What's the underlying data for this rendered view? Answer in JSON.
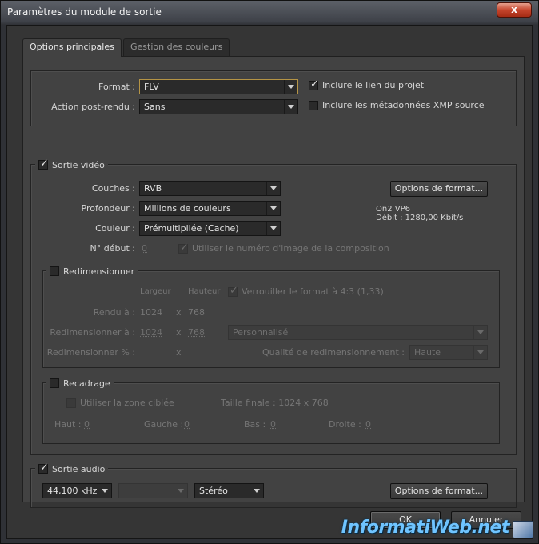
{
  "window": {
    "title": "Paramètres du module de sortie",
    "close_glyph": "x"
  },
  "tabs": [
    {
      "label": "Options principales",
      "active": true
    },
    {
      "label": "Gestion des couleurs",
      "active": false
    }
  ],
  "main": {
    "format_label": "Format :",
    "format_value": "FLV",
    "post_action_label": "Action post-rendu :",
    "post_action_value": "Sans",
    "include_project_link": {
      "label": "Inclure le lien du projet",
      "checked": true
    },
    "include_xmp": {
      "label": "Inclure les métadonnées XMP source",
      "checked": false
    }
  },
  "video": {
    "legend": "Sortie vidéo",
    "checked": true,
    "channels_label": "Couches :",
    "channels_value": "RVB",
    "depth_label": "Profondeur :",
    "depth_value": "Millions de couleurs",
    "color_label": "Couleur :",
    "color_value": "Prémultipliée (Cache)",
    "start_label": "N° début :",
    "start_value": "0",
    "use_comp_frame": {
      "label": "Utiliser le numéro d'image de la composition",
      "checked": true
    },
    "format_options_button": "Options de format...",
    "codec": "On2 VP6",
    "bitrate": "Débit : 1280,00 Kbit/s"
  },
  "resize": {
    "legend": "Redimensionner",
    "checked": false,
    "width_header": "Largeur",
    "height_header": "Hauteur",
    "lock_ratio": {
      "label": "Verrouiller le format à 4:3 (1,33)",
      "checked": true
    },
    "render_label": "Rendu à :",
    "render_w": "1024",
    "render_h": "768",
    "resize_to_label": "Redimensionner à :",
    "resize_w": "1024",
    "resize_h": "768",
    "preset_value": "Personnalisé",
    "percent_label": "Redimensionner % :",
    "x_glyph": "x",
    "quality_label": "Qualité de redimensionnement :",
    "quality_value": "Haute"
  },
  "crop": {
    "legend": "Recadrage",
    "checked": false,
    "use_target": {
      "label": "Utiliser la zone ciblée",
      "checked": false
    },
    "final_size": "Taille finale : 1024 x 768",
    "top_label": "Haut :",
    "top_value": "0",
    "left_label": "Gauche :",
    "left_value": "0",
    "bottom_label": "Bas :",
    "bottom_value": "0",
    "right_label": "Droite :",
    "right_value": "0"
  },
  "audio": {
    "legend": "Sortie audio",
    "checked": true,
    "rate_value": "44,100 kHz",
    "depth_value": "",
    "channels_value": "Stéréo",
    "format_options_button": "Options de format..."
  },
  "footer": {
    "ok_label": "OK",
    "cancel_label": "Annuler"
  },
  "watermark": "InformatiWeb.net",
  "colors": {
    "accent_focus": "#b59445",
    "panel": "#424242"
  }
}
